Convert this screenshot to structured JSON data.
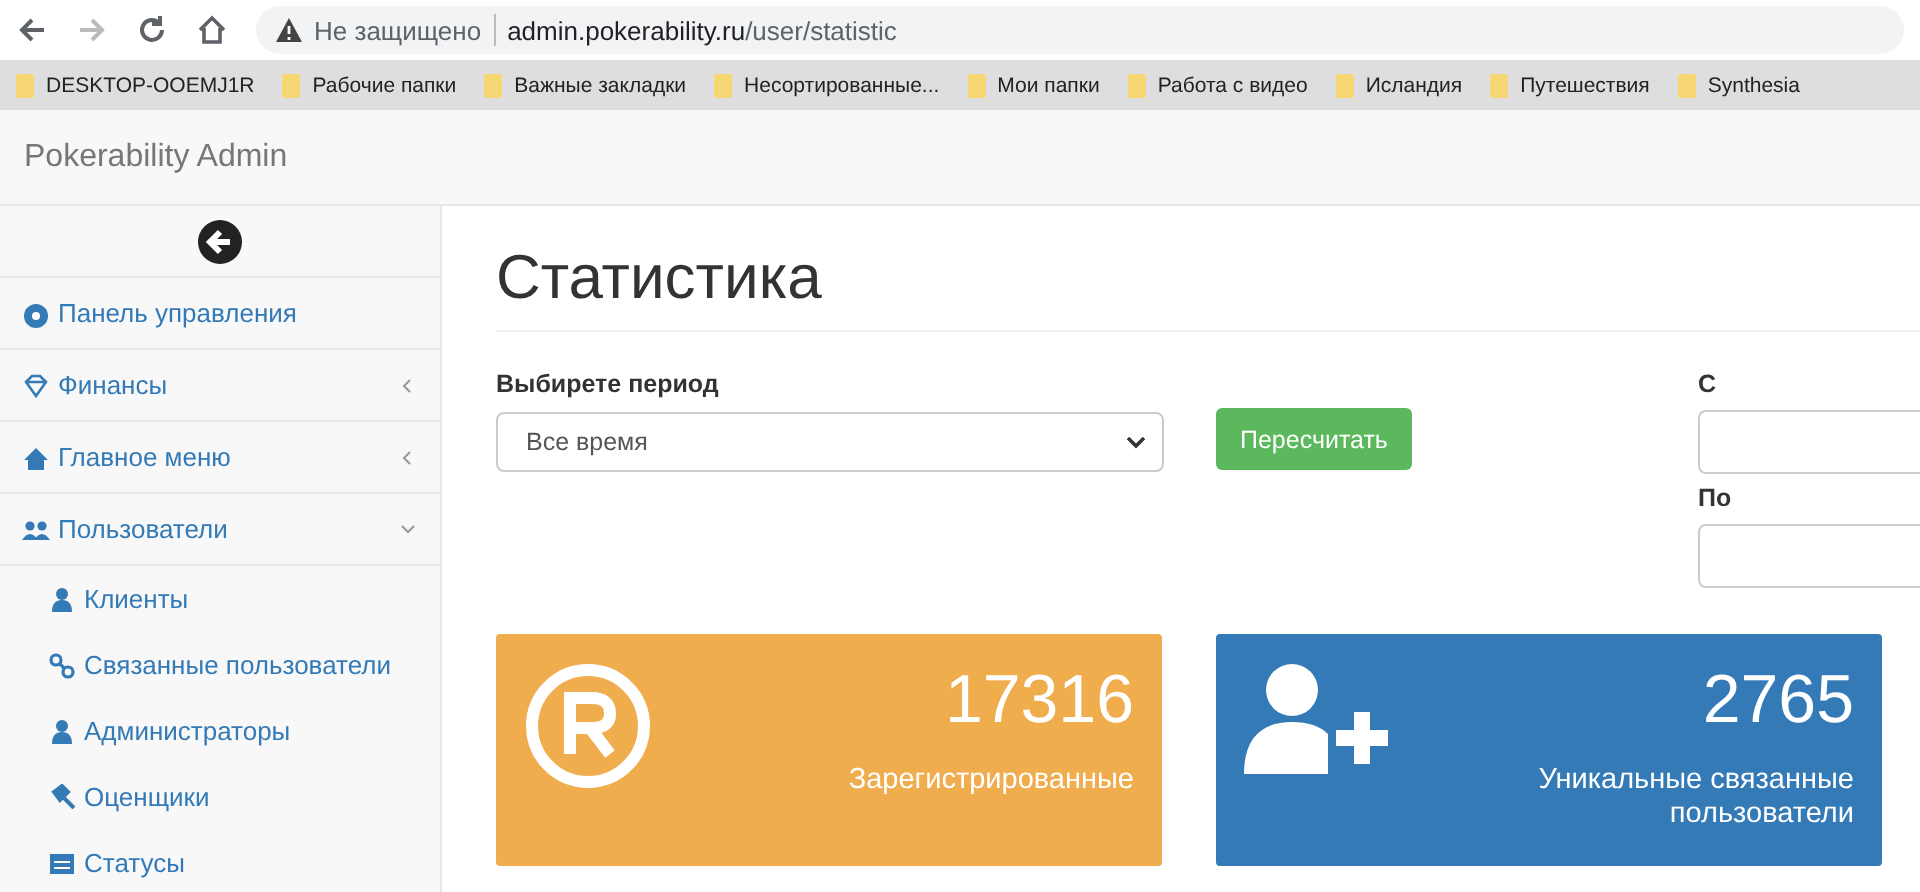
{
  "browser": {
    "security": "Не защищено",
    "host": "admin.pokerability.ru",
    "path": "/user/statistic",
    "bookmarks": [
      "DESKTOP-OOEMJ1R",
      "Рабочие папки",
      "Важные закладки",
      "Несортированные...",
      "Мои папки",
      "Работа с видео",
      "Исландия",
      "Путешествия",
      "Synthesia"
    ]
  },
  "navbar": {
    "brand": "Pokerability Admin"
  },
  "sidebar": {
    "items": [
      {
        "label": "Панель управления",
        "kind": "dashboard"
      },
      {
        "label": "Финансы",
        "kind": "diamond",
        "expanded": false
      },
      {
        "label": "Главное меню",
        "kind": "home",
        "expanded": false
      },
      {
        "label": "Пользователи",
        "kind": "users",
        "expanded": true,
        "children": [
          {
            "label": "Клиенты",
            "kind": "user"
          },
          {
            "label": "Связанные пользователи",
            "kind": "link"
          },
          {
            "label": "Администраторы",
            "kind": "user"
          },
          {
            "label": "Оценщики",
            "kind": "gavel"
          },
          {
            "label": "Статусы",
            "kind": "list"
          }
        ]
      }
    ]
  },
  "page": {
    "title": "Статистика",
    "period_label": "Выбирете период",
    "period_value": "Все время",
    "recalc_button": "Пересчитать",
    "from_label": "С",
    "to_label": "По"
  },
  "cards": [
    {
      "value": "17316",
      "label": "Зарегистрированные",
      "kind": "registered",
      "color": "#f0ad4e"
    },
    {
      "value": "2765",
      "label": "Уникальные связанные пользователи",
      "kind": "user-plus",
      "color": "#337ab7"
    }
  ]
}
